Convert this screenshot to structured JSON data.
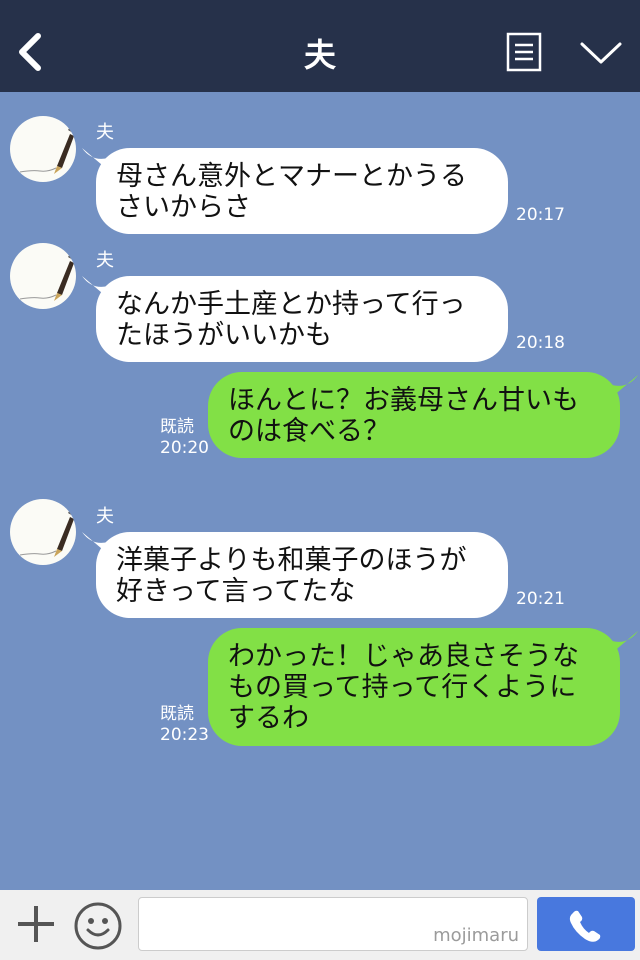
{
  "header": {
    "title": "夫"
  },
  "messages": [
    {
      "sender": "夫",
      "text": "母さん意外とマナーとかうるさいからさ",
      "time": "20:17"
    },
    {
      "sender": "夫",
      "text": "なんか手土産とか持って行ったほうがいいかも",
      "time": "20:18"
    },
    {
      "text": "ほんとに？お義母さん甘いものは食べる？",
      "read": "既読",
      "time": "20:20"
    },
    {
      "sender": "夫",
      "text": "洋菓子よりも和菓子のほうが好きって言ってたな",
      "time": "20:21"
    },
    {
      "text": "わかった！じゃあ良さそうなもの買って持って行くようにするわ",
      "read": "既読",
      "time": "20:23"
    }
  ],
  "footer": {
    "input_value": "",
    "watermark": "mojimaru"
  },
  "icons": {
    "back": "chevron-left-icon",
    "menu": "menu-icon",
    "collapse": "chevron-down-icon",
    "add": "plus-icon",
    "emoji": "smiley-icon",
    "call": "phone-icon"
  },
  "colors": {
    "header": "#26314a",
    "chat_bg": "#7391c3",
    "sent_bubble": "#82e046",
    "received_bubble": "#ffffff",
    "call_button": "#4878de"
  }
}
